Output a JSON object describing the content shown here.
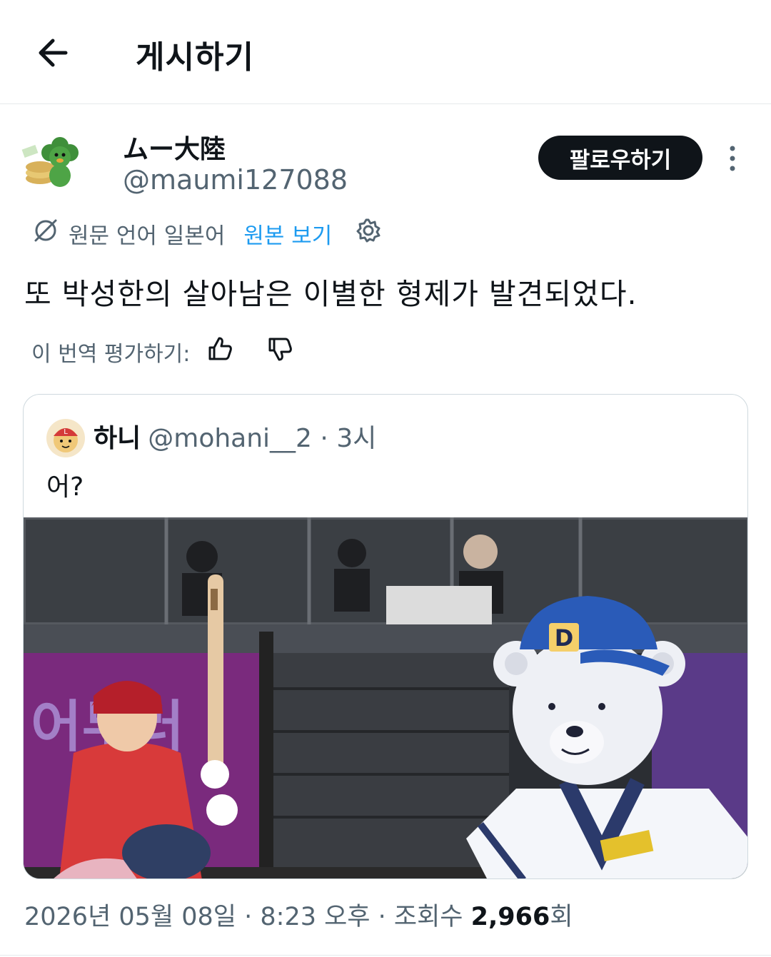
{
  "header": {
    "title": "게시하기",
    "back_icon": "arrow-left-icon"
  },
  "author": {
    "display_name": "ムー大陸",
    "handle": "@maumi127088",
    "follow_label": "팔로우하기",
    "more_icon": "more-vertical-icon"
  },
  "translation": {
    "info": "원문 언어 일본어",
    "view_original": "원본 보기",
    "settings_icon": "gear-icon",
    "link_color": "#1d9bf0"
  },
  "tweet": {
    "text": "또 박성한의 살아남은 이별한 형제가 발견되었다."
  },
  "rating": {
    "label": "이 번역 평가하기:",
    "up_icon": "thumbs-up-icon",
    "down_icon": "thumbs-down-icon"
  },
  "quote": {
    "name": "하니",
    "handle": "@mohani__2",
    "dot": "·",
    "time": "3시",
    "text": "어?"
  },
  "meta": {
    "date": "2026년 05월 08일",
    "sep1": " · ",
    "time": "8:23 오후",
    "sep2": " · ",
    "views_label": "조회수 ",
    "views_count": "2,966",
    "views_suffix": "회"
  }
}
